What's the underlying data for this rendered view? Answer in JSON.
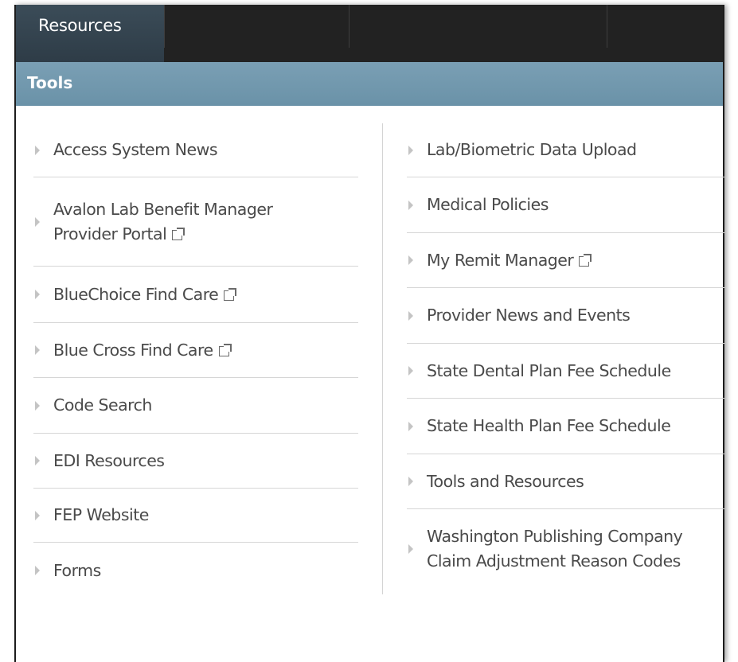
{
  "topnav": {
    "active_tab": "Resources"
  },
  "section": {
    "title": "Tools"
  },
  "left_links": [
    {
      "label": "Access System News",
      "external": false
    },
    {
      "label": "Avalon Lab Benefit Manager Provider Portal",
      "external": true
    },
    {
      "label": "BlueChoice Find Care",
      "external": true
    },
    {
      "label": "Blue Cross Find Care",
      "external": true
    },
    {
      "label": "Code Search",
      "external": false
    },
    {
      "label": "EDI Resources",
      "external": false
    },
    {
      "label": "FEP Website",
      "external": false
    },
    {
      "label": "Forms",
      "external": false
    }
  ],
  "right_links": [
    {
      "label": "Lab/Biometric Data Upload",
      "external": false
    },
    {
      "label": "Medical Policies",
      "external": false
    },
    {
      "label": "My Remit Manager",
      "external": true
    },
    {
      "label": "Provider News and Events",
      "external": false
    },
    {
      "label": "State Dental Plan Fee Schedule",
      "external": false
    },
    {
      "label": "State Health Plan Fee Schedule",
      "external": false
    },
    {
      "label": "Tools and Resources",
      "external": false
    },
    {
      "label": "Washington Publishing Company Claim Adjustment Reason Codes",
      "external": false
    }
  ]
}
